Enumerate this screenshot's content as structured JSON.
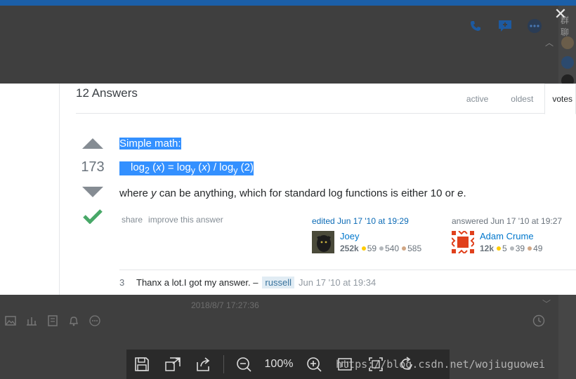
{
  "background": {
    "right_panel_text": "群聊",
    "timestamp": "2018/8/7 17:27:36"
  },
  "viewer": {
    "close_label": "✕",
    "zoom_level": "100%"
  },
  "answers": {
    "title": "12 Answers",
    "tabs": [
      {
        "label": "active"
      },
      {
        "label": "oldest"
      },
      {
        "label": "votes"
      }
    ],
    "vote_count": "173",
    "post": {
      "line1": "Simple math:",
      "line2_parts": [
        "log",
        "2",
        " (",
        "x",
        ") = log",
        "y",
        " (",
        "x",
        ") / log",
        "y",
        " (2)"
      ],
      "line3_parts": [
        "where ",
        "y",
        " can be anything, which for standard log functions is either 10 or ",
        "e",
        "."
      ]
    },
    "menu": {
      "share": "share",
      "improve": "improve this answer"
    },
    "edited": {
      "action": "edited Jun 17 '10 at 19:29",
      "user": "Joey",
      "rep": "252k",
      "gold": "59",
      "silver": "540",
      "bronze": "585"
    },
    "answered": {
      "action": "answered Jun 17 '10 at 19:27",
      "user": "Adam Crume",
      "rep": "12k",
      "gold": "5",
      "silver": "39",
      "bronze": "49"
    },
    "comment": {
      "score": "3",
      "text": "Thanx a lot.I got my answer. –",
      "user": "russell",
      "date": "Jun 17 '10 at 19:34"
    }
  },
  "watermark": "https://blog.csdn.net/wojiuguowei",
  "colors": {
    "selection": "#3390ff",
    "accept": "#48a868",
    "gold": "#ffcc01",
    "silver": "#b4b8bc",
    "bronze": "#d1a684"
  }
}
